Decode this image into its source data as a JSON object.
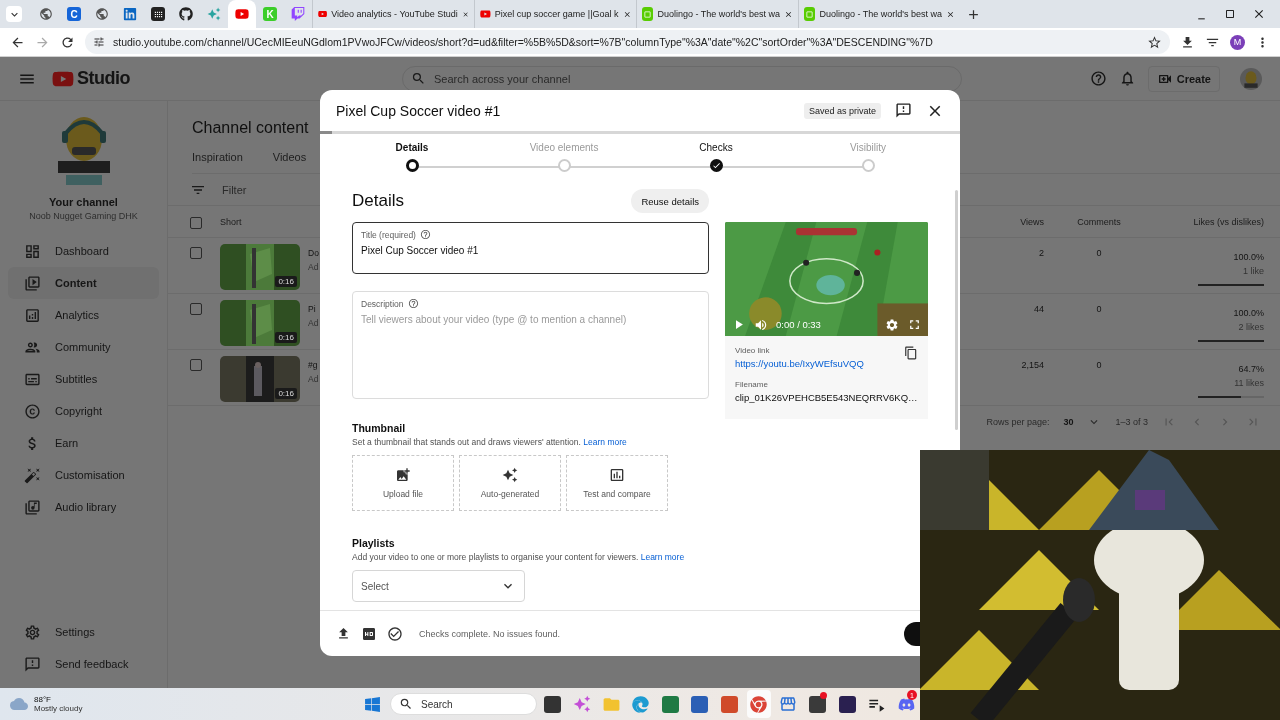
{
  "browser": {
    "pinned_tabs": [
      {
        "kind": "globe",
        "selected": false
      },
      {
        "kind": "letter",
        "glyph": "C",
        "selected": false
      },
      {
        "kind": "globe",
        "selected": false
      },
      {
        "kind": "linkedin",
        "selected": false
      },
      {
        "kind": "app",
        "selected": false
      },
      {
        "kind": "github",
        "selected": false
      },
      {
        "kind": "pinwheel",
        "selected": false
      },
      {
        "kind": "youtube",
        "selected": true
      },
      {
        "kind": "letter",
        "glyph": "K",
        "selected": false
      },
      {
        "kind": "twitch",
        "selected": false
      }
    ],
    "tabs": [
      {
        "title": "Video analytics - YouTube Studi",
        "kind": "youtube",
        "selected": false
      },
      {
        "title": "Pixel cup soccer game ||Goal k",
        "kind": "youtube",
        "selected": false
      },
      {
        "title": "Duolingo - The world's best wa",
        "kind": "duolingo",
        "selected": false
      },
      {
        "title": "Duolingo - The world's best wa",
        "kind": "duolingo",
        "selected": false
      }
    ],
    "url": "studio.youtube.com/channel/UCecMIEeuNGdlom1PVwoJFCw/videos/short?d=ud&filter=%5B%5D&sort=%7B\"columnType\"%3A\"date\"%2C\"sortOrder\"%3A\"DESCENDING\"%7D",
    "profile_initial": "M"
  },
  "studio": {
    "logo_text": "Studio",
    "search_placeholder": "Search across your channel",
    "create_label": "Create",
    "channel": {
      "label": "Your channel",
      "name": "Noob Nugget Gaming DHK"
    },
    "nav": [
      {
        "label": "Dashboard",
        "kind": "dashboard",
        "selected": false
      },
      {
        "label": "Content",
        "kind": "content",
        "selected": true
      },
      {
        "label": "Analytics",
        "kind": "analytics",
        "selected": false
      },
      {
        "label": "Community",
        "kind": "community",
        "selected": false
      },
      {
        "label": "Subtitles",
        "kind": "subtitles",
        "selected": false
      },
      {
        "label": "Copyright",
        "kind": "copyright",
        "selected": false
      },
      {
        "label": "Earn",
        "kind": "earn",
        "selected": false
      },
      {
        "label": "Customisation",
        "kind": "customisation",
        "selected": false
      },
      {
        "label": "Audio library",
        "kind": "audio",
        "selected": false
      }
    ],
    "footer_nav": [
      {
        "label": "Settings",
        "kind": "settings"
      },
      {
        "label": "Send feedback",
        "kind": "feedback"
      }
    ],
    "page_title": "Channel content",
    "content_tabs": [
      "Inspiration",
      "Videos"
    ],
    "filter_placeholder": "Filter",
    "table": {
      "select_all_checked": false,
      "columns": [
        "Short",
        "Views",
        "Comments",
        "Likes (vs dislikes)"
      ],
      "rows": [
        {
          "checked": false,
          "title": "Do",
          "subtitle": "Ad",
          "duration": "0:16",
          "views": "2",
          "comments": "0",
          "likes_pct": "100.0%",
          "likes": "1 like",
          "level": 1
        },
        {
          "checked": false,
          "title": "Pi",
          "subtitle": "Ad",
          "duration": "0:16",
          "views": "44",
          "comments": "0",
          "likes_pct": "100.0%",
          "likes": "2 likes",
          "level": 1
        },
        {
          "checked": false,
          "title": "#g",
          "subtitle": "Ad",
          "duration": "0:16",
          "views": "2,154",
          "comments": "0",
          "likes_pct": "64.7%",
          "likes": "11 likes",
          "level": 0.647
        }
      ]
    },
    "pagination": {
      "label": "Rows per page:",
      "rows": "30",
      "range": "1–3 of 3"
    }
  },
  "dialog": {
    "title": "Pixel Cup Soccer video #1",
    "status": "Saved as private",
    "steps": [
      {
        "label": "Details",
        "completed": false,
        "selected": true
      },
      {
        "label": "Video elements",
        "completed": false,
        "selected": false
      },
      {
        "label": "Checks",
        "completed": true,
        "selected": false
      },
      {
        "label": "Visibility",
        "completed": false,
        "selected": false
      }
    ],
    "heading": "Details",
    "reuse_button": "Reuse details",
    "title_field": {
      "label": "Title (required)",
      "value": "Pixel Cup Soccer video #1"
    },
    "description_field": {
      "label": "Description",
      "placeholder": "Tell viewers about your video (type @ to mention a channel)"
    },
    "player": {
      "time": "0:00 / 0:33"
    },
    "video_link": {
      "label": "Video link",
      "url": "https://youtu.be/IxyWEfsuVQQ"
    },
    "filename": {
      "label": "Filename",
      "value": "clip_01K26VPEHCB5E543NEQRRV6KQ…"
    },
    "thumbnail": {
      "heading": "Thumbnail",
      "text": "Set a thumbnail that stands out and draws viewers' attention.",
      "link": "Learn more",
      "options": [
        {
          "label": "Upload file",
          "kind": "upload"
        },
        {
          "label": "Auto-generated",
          "kind": "auto"
        },
        {
          "label": "Test and compare",
          "kind": "test"
        }
      ]
    },
    "playlists": {
      "heading": "Playlists",
      "text": "Add your video to one or more playlists to organise your content for viewers.",
      "link": "Learn more",
      "select": "Select"
    },
    "footer_status": "Checks complete. No issues found."
  },
  "taskbar": {
    "weather": {
      "temp": "88°F",
      "condition": "Mostly cloudy"
    },
    "search": "Search",
    "apps": [
      {
        "kind": "taskview",
        "selected": false
      },
      {
        "kind": "copilot",
        "selected": false
      },
      {
        "kind": "explorer",
        "selected": false
      },
      {
        "kind": "edge",
        "selected": false
      },
      {
        "kind": "excel",
        "selected": false
      },
      {
        "kind": "word",
        "selected": false
      },
      {
        "kind": "powerpoint",
        "selected": false
      },
      {
        "kind": "chrome",
        "selected": true
      },
      {
        "kind": "store",
        "selected": false
      },
      {
        "kind": "obs",
        "selected": false,
        "notification": true
      },
      {
        "kind": "game",
        "selected": false
      },
      {
        "kind": "player",
        "selected": false
      },
      {
        "kind": "discord",
        "selected": false,
        "badge": "1"
      }
    ]
  }
}
